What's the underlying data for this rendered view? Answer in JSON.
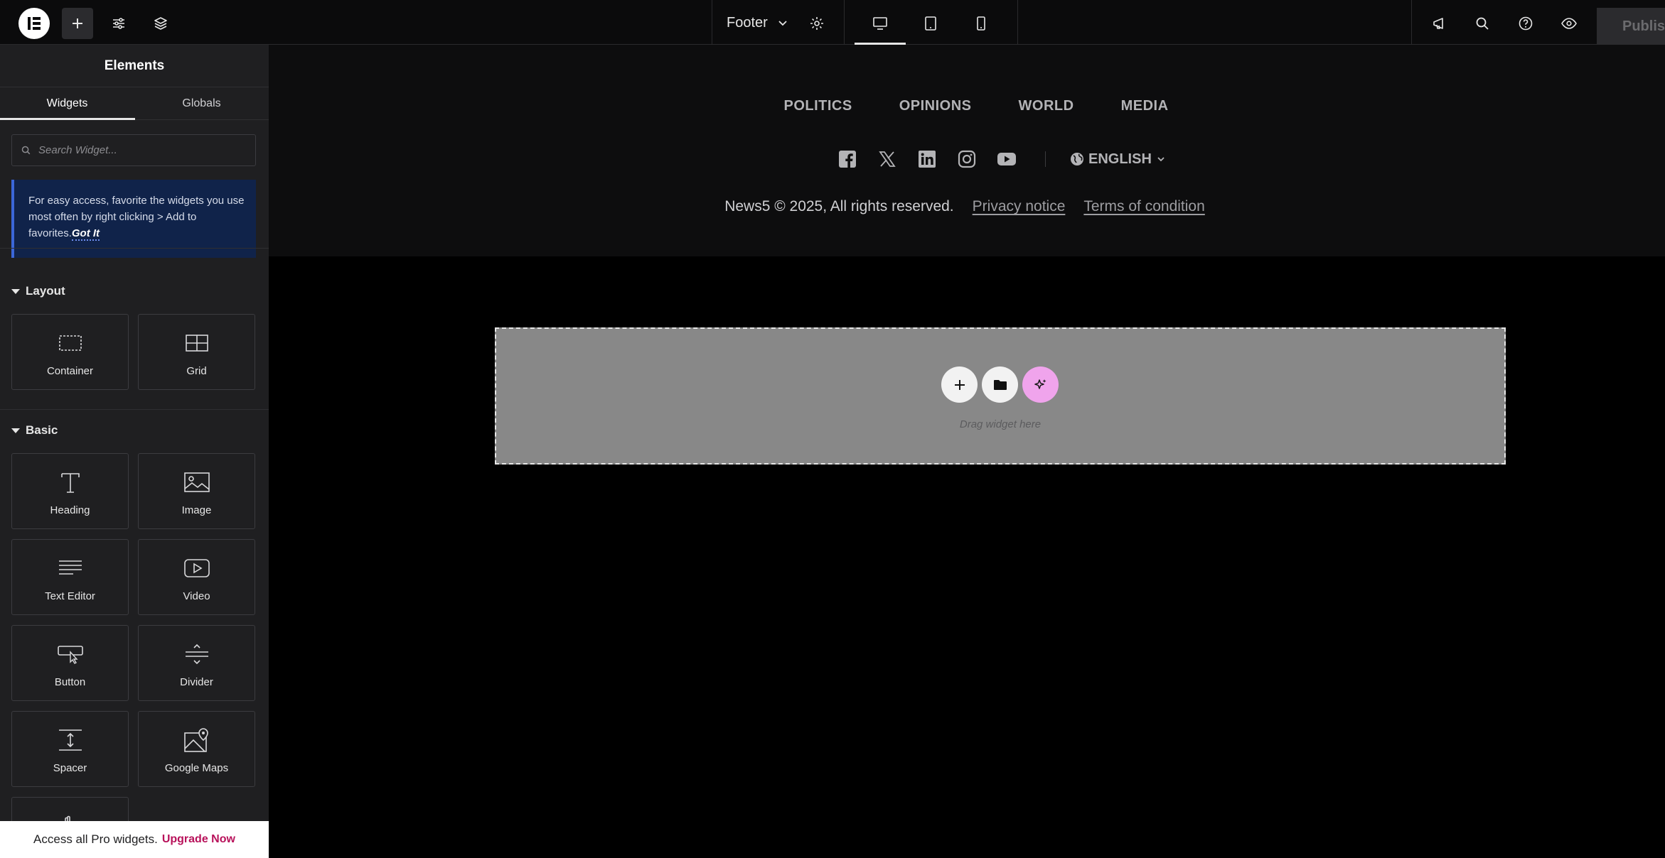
{
  "topbar": {
    "logo_icon": "elementor-logo-icon",
    "add_icon": "plus-icon",
    "settings_icon": "sliders-icon",
    "structure_icon": "layers-icon",
    "document_name": "Footer",
    "document_settings_icon": "gear-icon",
    "devices": [
      "desktop",
      "tablet",
      "mobile"
    ],
    "active_device": "desktop",
    "right_icons": [
      "whats-new-icon",
      "search-icon",
      "help-icon",
      "preview-eye-icon"
    ],
    "publish_label": "Publish"
  },
  "sidebar": {
    "title": "Elements",
    "tabs": [
      {
        "label": "Widgets",
        "active": true
      },
      {
        "label": "Globals",
        "active": false
      }
    ],
    "search_placeholder": "Search Widget...",
    "notice_text": "For easy access, favorite the widgets you use most often by right clicking > Add to favorites.",
    "notice_link": "Got It",
    "sections": [
      {
        "title": "Layout",
        "widgets": [
          {
            "label": "Container",
            "icon": "container-icon"
          },
          {
            "label": "Grid",
            "icon": "grid-icon"
          }
        ]
      },
      {
        "title": "Basic",
        "widgets": [
          {
            "label": "Heading",
            "icon": "heading-icon"
          },
          {
            "label": "Image",
            "icon": "image-icon"
          },
          {
            "label": "Text Editor",
            "icon": "text-editor-icon"
          },
          {
            "label": "Video",
            "icon": "video-icon"
          },
          {
            "label": "Button",
            "icon": "button-icon"
          },
          {
            "label": "Divider",
            "icon": "divider-icon"
          },
          {
            "label": "Spacer",
            "icon": "spacer-icon"
          },
          {
            "label": "Google Maps",
            "icon": "google-maps-icon"
          }
        ]
      }
    ],
    "upgrade_text": "Access all Pro widgets.",
    "upgrade_link": "Upgrade Now"
  },
  "canvas": {
    "nav": [
      "POLITICS",
      "OPINIONS",
      "WORLD",
      "MEDIA"
    ],
    "social_icons": [
      "facebook-icon",
      "x-icon",
      "linkedin-icon",
      "instagram-icon",
      "youtube-icon"
    ],
    "language": "ENGLISH",
    "copyright": "News5 © 2025, All rights reserved.",
    "links": [
      "Privacy notice",
      "Terms of condition"
    ],
    "dropzone_text": "Drag widget here",
    "dropzone_buttons": [
      "plus-icon",
      "folder-icon",
      "ai-sparkle-icon"
    ]
  },
  "colors": {
    "accent_ai": "#f0a4ec",
    "upgrade_link": "#b8115a",
    "notice_bg": "#10234a"
  }
}
